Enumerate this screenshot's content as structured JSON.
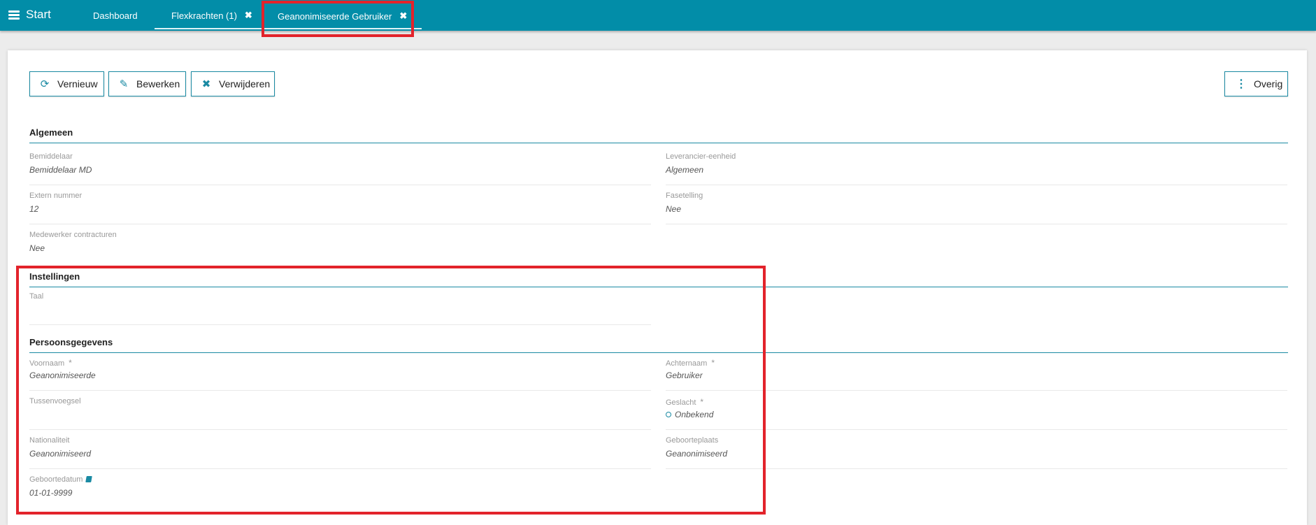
{
  "topbar": {
    "start_label": "Start",
    "tabs": [
      {
        "label": "Dashboard"
      },
      {
        "label": "Flexkrachten (1)",
        "close": "✖"
      },
      {
        "label": "Geanonimiseerde Gebruiker",
        "close": "✖"
      }
    ]
  },
  "toolbar": {
    "refresh_label": "Vernieuw",
    "edit_label": "Bewerken",
    "delete_label": "Verwijderen",
    "more_label": "Overig"
  },
  "sections": {
    "general": "Algemeen",
    "settings": "Instellingen",
    "personal": "Persoonsgegevens"
  },
  "fields": {
    "bemiddelaar": {
      "label": "Bemiddelaar",
      "value": "Bemiddelaar MD"
    },
    "leverancier": {
      "label": "Leverancier-eenheid",
      "value": "Algemeen"
    },
    "extern": {
      "label": "Extern nummer",
      "value": "12"
    },
    "fasetelling": {
      "label": "Fasetelling",
      "value": "Nee"
    },
    "contracturen": {
      "label": "Medewerker contracturen",
      "value": "Nee"
    },
    "taal": {
      "label": "Taal",
      "value": ""
    },
    "voornaam": {
      "label": "Voornaam",
      "value": "Geanonimiseerde"
    },
    "achternaam": {
      "label": "Achternaam",
      "value": "Gebruiker"
    },
    "tussenvoegsel": {
      "label": "Tussenvoegsel",
      "value": ""
    },
    "geslacht": {
      "label": "Geslacht",
      "value": "Onbekend"
    },
    "nationaliteit": {
      "label": "Nationaliteit",
      "value": "Geanonimiseerd"
    },
    "geboorteplaats": {
      "label": "Geboorteplaats",
      "value": "Geanonimiseerd"
    },
    "geboortedatum": {
      "label": "Geboortedatum",
      "value": "01-01-9999"
    }
  },
  "required_marker": "*",
  "colors": {
    "topbar": "#028da8",
    "accent": "#1a8aa3",
    "highlight": "#e2232b"
  }
}
